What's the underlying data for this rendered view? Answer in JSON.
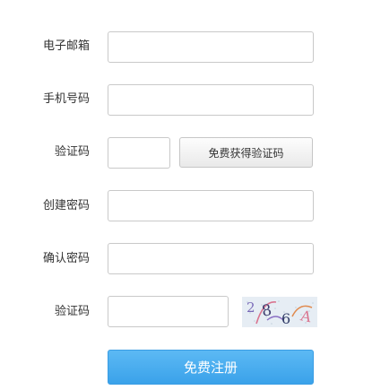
{
  "form": {
    "email_label": "电子邮箱",
    "email_value": "",
    "phone_label": "手机号码",
    "phone_value": "",
    "sms_code_label": "验证码",
    "sms_code_value": "",
    "get_code_button": "免费获得验证码",
    "password_label": "创建密码",
    "password_value": "",
    "confirm_label": "确认密码",
    "confirm_value": "",
    "captcha_label": "验证码",
    "captcha_value": "",
    "captcha_text": "286A",
    "submit_button": "免费注册"
  },
  "colors": {
    "submit_bg": "#42a5ed",
    "label_text": "#333333",
    "field_border": "#c9c9c9"
  }
}
